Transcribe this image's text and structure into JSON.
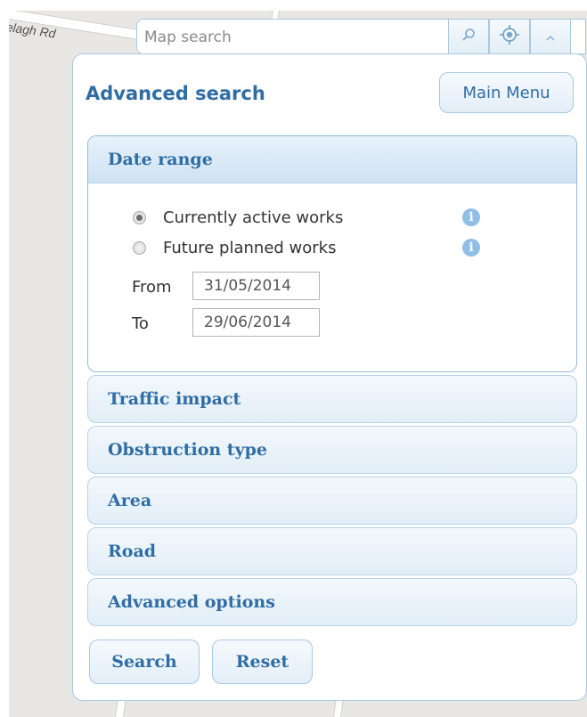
{
  "map": {
    "road_label": "elagh Rd"
  },
  "search": {
    "placeholder": "Map search"
  },
  "panel": {
    "title": "Advanced search",
    "main_menu_label": "Main Menu"
  },
  "date_range": {
    "heading": "Date range",
    "options": [
      {
        "label": "Currently active works",
        "checked": true
      },
      {
        "label": "Future planned works",
        "checked": false
      }
    ],
    "from_label": "From",
    "from_value": "31/05/2014",
    "to_label": "To",
    "to_value": "29/06/2014"
  },
  "sections": [
    {
      "heading": "Traffic impact"
    },
    {
      "heading": "Obstruction type"
    },
    {
      "heading": "Area"
    },
    {
      "heading": "Road"
    },
    {
      "heading": "Advanced options"
    }
  ],
  "actions": {
    "search_label": "Search",
    "reset_label": "Reset"
  },
  "icons": {
    "search": "search-icon",
    "locate": "target-icon",
    "collapse": "chevron-up-icon",
    "info": "info-icon"
  },
  "colors": {
    "accent": "#2f6da3",
    "border": "#a8c9e4",
    "map_background": "#e9e7e4"
  }
}
